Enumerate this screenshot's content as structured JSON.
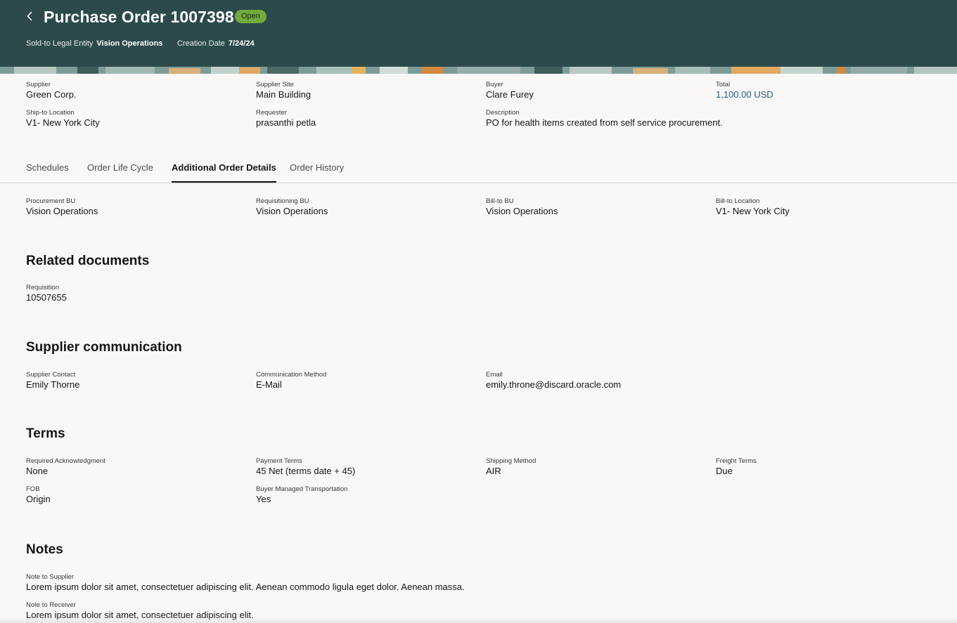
{
  "header": {
    "title": "Purchase Order 1007398",
    "status": "Open",
    "status_color": "#74a93e",
    "background_color": "#2c4a4b",
    "back_icon": "chevron-left-icon",
    "sold_to_label": "Sold-to Legal Entity",
    "sold_to_value": "Vision Operations",
    "creation_date_label": "Creation Date",
    "creation_date_value": "7/24/24"
  },
  "summary": {
    "supplier": {
      "label": "Supplier",
      "value": "Green Corp."
    },
    "supplier_site": {
      "label": "Supplier Site",
      "value": "Main Building"
    },
    "buyer": {
      "label": "Buyer",
      "value": "Clare Furey"
    },
    "total": {
      "label": "Total",
      "value": "1,100.00 USD"
    },
    "ship_to": {
      "label": "Ship-to Location",
      "value": "V1- New York City"
    },
    "requester": {
      "label": "Requester",
      "value": "prasanthi petla"
    },
    "description": {
      "label": "Description",
      "value": "PO for health items created from self service procurement."
    }
  },
  "tabs": [
    {
      "label": "Schedules",
      "active": false
    },
    {
      "label": "Order Life Cycle",
      "active": false
    },
    {
      "label": "Additional Order Details",
      "active": true
    },
    {
      "label": "Order History",
      "active": false
    }
  ],
  "details": {
    "procurement_bu": {
      "label": "Procurement BU",
      "value": "Vision Operations"
    },
    "requisitioning_bu": {
      "label": "Requisitioning BU",
      "value": "Vision Operations"
    },
    "bill_to_bu": {
      "label": "Bill-to BU",
      "value": "Vision Operations"
    },
    "bill_to_location": {
      "label": "Bill-to Location",
      "value": "V1- New York City"
    }
  },
  "related_documents": {
    "title": "Related documents",
    "requisition": {
      "label": "Requisition",
      "value": "10507655"
    }
  },
  "supplier_communication": {
    "title": "Supplier communication",
    "contact": {
      "label": "Supplier Contact",
      "value": "Emily Thorne"
    },
    "method": {
      "label": "Communication Method",
      "value": "E-Mail"
    },
    "email": {
      "label": "Email",
      "value": "emily.throne@discard.oracle.com"
    }
  },
  "terms": {
    "title": "Terms",
    "required_ack": {
      "label": "Required Acknowledgment",
      "value": "None"
    },
    "payment_terms": {
      "label": "Payment Terms",
      "value": "45 Net (terms date + 45)"
    },
    "shipping_method": {
      "label": "Shipping Method",
      "value": "AIR"
    },
    "freight_terms": {
      "label": "Freight Terms",
      "value": "Due"
    },
    "fob": {
      "label": "FOB",
      "value": "Origin"
    },
    "buyer_managed": {
      "label": "Buyer Managed Transportation",
      "value": "Yes"
    }
  },
  "notes": {
    "title": "Notes",
    "to_supplier": {
      "label": "Note to Supplier",
      "value": "Lorem ipsum dolor sit amet, consectetuer adipiscing elit. Aenean commodo ligula eget dolor. Aenean massa."
    },
    "to_receiver": {
      "label": "Note to Receiver",
      "value": "Lorem ipsum dolor sit amet, consectetuer adipiscing elit."
    }
  }
}
